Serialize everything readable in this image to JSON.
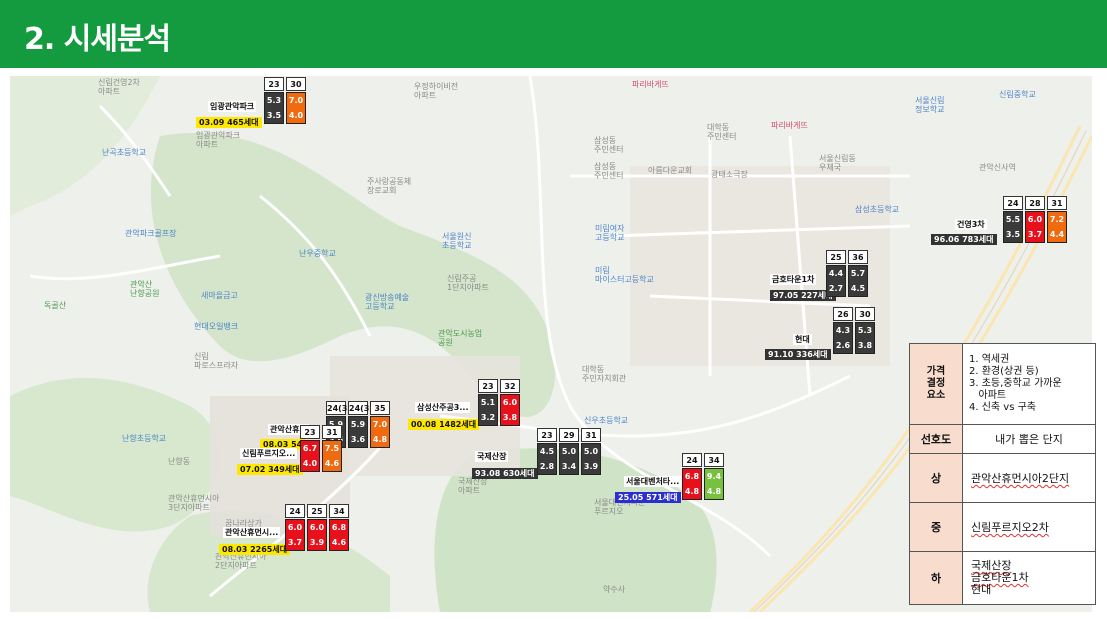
{
  "header": {
    "title": "2. 시세분석"
  },
  "map_labels": [
    {
      "text": "신림건영2차\n아파트",
      "cls": ""
    },
    {
      "text": "우정하이비전\n아파트",
      "cls": ""
    },
    {
      "text": "삼성동\n주민센터",
      "cls": ""
    },
    {
      "text": "삼성동\n주민센터",
      "cls": ""
    },
    {
      "text": "파리바게뜨",
      "cls": "red"
    },
    {
      "text": "대학동\n주민센터",
      "cls": ""
    },
    {
      "text": "서울신림\n정보학교",
      "cls": "blue"
    },
    {
      "text": "신림중학교",
      "cls": "blue"
    },
    {
      "text": "난곡초등학교",
      "cls": "blue"
    },
    {
      "text": "주사랑공동체\n장로교회",
      "cls": ""
    },
    {
      "text": "아름다운교회",
      "cls": ""
    },
    {
      "text": "광태소극장",
      "cls": ""
    },
    {
      "text": "서울신림동\n우체국",
      "cls": ""
    },
    {
      "text": "관악신사역",
      "cls": ""
    },
    {
      "text": "삼성초등학교",
      "cls": "blue"
    },
    {
      "text": "관악파크골프장",
      "cls": "blue"
    },
    {
      "text": "서울원신\n초등학교",
      "cls": "blue"
    },
    {
      "text": "미림여자\n고등학교",
      "cls": "blue"
    },
    {
      "text": "미림\n마이스터고등학교",
      "cls": "blue"
    },
    {
      "text": "난우중학교",
      "cls": "blue"
    },
    {
      "text": "관악산\n난향공원",
      "cls": "green"
    },
    {
      "text": "새마을금고",
      "cls": "blue"
    },
    {
      "text": "신림주공\n1단지아파트",
      "cls": ""
    },
    {
      "text": "독골산",
      "cls": "green"
    },
    {
      "text": "현대오일뱅크",
      "cls": "blue"
    },
    {
      "text": "광신방송예술\n고등학교",
      "cls": "blue"
    },
    {
      "text": "관악도시농업\n공원",
      "cls": "green"
    },
    {
      "text": "신림\n파로스프라자",
      "cls": ""
    },
    {
      "text": "대학동\n주민자치회관",
      "cls": ""
    },
    {
      "text": "난향초등학교",
      "cls": "blue"
    },
    {
      "text": "난향동",
      "cls": ""
    },
    {
      "text": "신우초등학교",
      "cls": "blue"
    },
    {
      "text": "관악산휴먼시아\n3단지아파트",
      "cls": ""
    },
    {
      "text": "꿈나라상가",
      "cls": ""
    },
    {
      "text": "국제산장\n아파트",
      "cls": ""
    },
    {
      "text": "서울대벤처타운\n푸르지오",
      "cls": ""
    },
    {
      "text": "관악산휴먼시아\n2단지아파트",
      "cls": ""
    },
    {
      "text": "약수사",
      "cls": ""
    },
    {
      "text": "파리바게뜨",
      "cls": "red"
    },
    {
      "text": "임광관악파크\n아파트",
      "cls": ""
    }
  ],
  "apartments": [
    {
      "id": "imgwang",
      "headers": [
        "23",
        "30"
      ],
      "cols": [
        {
          "c": "dark",
          "a": "5.3",
          "b": "3.5"
        },
        {
          "c": "orange",
          "a": "7.0",
          "b": "4.0"
        }
      ],
      "name": "임광관악파크",
      "info": "03.09 465세대",
      "info_cls": "yellow"
    },
    {
      "id": "geonyoung",
      "headers": [
        "24",
        "28",
        "31"
      ],
      "cols": [
        {
          "c": "dark",
          "a": "5.5",
          "b": "3.5"
        },
        {
          "c": "red",
          "a": "6.0",
          "b": "3.7"
        },
        {
          "c": "orange",
          "a": "7.2",
          "b": "4.4"
        }
      ],
      "name": "건영3차",
      "info": "96.06 783세대",
      "info_cls": "dark"
    },
    {
      "id": "geumho",
      "headers": [
        "25",
        "36"
      ],
      "cols": [
        {
          "c": "dark",
          "a": "4.4",
          "b": "2.7"
        },
        {
          "c": "dark",
          "a": "5.7",
          "b": "4.5"
        }
      ],
      "name": "금호타운1차",
      "info": "97.05 227세대",
      "info_cls": "dark"
    },
    {
      "id": "hyundai",
      "headers": [
        "26",
        "30"
      ],
      "cols": [
        {
          "c": "dark",
          "a": "4.3",
          "b": "2.6"
        },
        {
          "c": "dark",
          "a": "5.3",
          "b": "3.8"
        }
      ],
      "name": "현대",
      "info": "91.10 336세대",
      "info_cls": "dark"
    },
    {
      "id": "samsung",
      "headers": [
        "23",
        "32"
      ],
      "cols": [
        {
          "c": "dark",
          "a": "5.1",
          "b": "3.2"
        },
        {
          "c": "red",
          "a": "6.0",
          "b": "3.8"
        }
      ],
      "name": "삼성산주공3...",
      "info": "00.08 1482세대",
      "info_cls": "yellow"
    },
    {
      "id": "gukje",
      "headers": [
        "23",
        "29",
        "31"
      ],
      "cols": [
        {
          "c": "dark",
          "a": "4.5",
          "b": "2.8"
        },
        {
          "c": "dark",
          "a": "5.0",
          "b": "3.4"
        },
        {
          "c": "dark",
          "a": "5.0",
          "b": "3.9"
        }
      ],
      "name": "국제산장",
      "info": "93.08 630세대",
      "info_cls": "dark"
    },
    {
      "id": "venture",
      "headers": [
        "24",
        "34"
      ],
      "cols": [
        {
          "c": "red",
          "a": "6.8",
          "b": "4.8"
        },
        {
          "c": "green",
          "a": "9.4",
          "b": "4.8"
        }
      ],
      "name": "서울대벤처타...",
      "info": "25.05 571세대",
      "info_cls": "blue"
    },
    {
      "id": "human2",
      "headers": [
        "24",
        "25",
        "34"
      ],
      "cols": [
        {
          "c": "red",
          "a": "6.0",
          "b": "3.7"
        },
        {
          "c": "red",
          "a": "6.0",
          "b": "3.9"
        },
        {
          "c": "red",
          "a": "6.8",
          "b": "4.6"
        }
      ],
      "name": "관악산휴먼시...",
      "info": "08.03 2265세대",
      "info_cls": "yellow"
    },
    {
      "id": "human3",
      "headers": [
        "24(3.",
        "24(3.",
        "35"
      ],
      "cols": [
        {
          "c": "dark",
          "a": "5.9",
          "b": "3.6"
        },
        {
          "c": "dark",
          "a": "5.9",
          "b": "3.6"
        },
        {
          "c": "orange",
          "a": "7.0",
          "b": "4.8"
        }
      ],
      "name": "관악산휴먼",
      "info": "08.03 54",
      "info_cls": "yellow"
    },
    {
      "id": "prugio",
      "headers": [
        "23",
        "31"
      ],
      "cols": [
        {
          "c": "red",
          "a": "6.7",
          "b": "4.0"
        },
        {
          "c": "orange",
          "a": "7.5",
          "b": "4.6"
        }
      ],
      "name": "신림푸르지오...",
      "info": "07.02 349세대",
      "info_cls": "yellow"
    }
  ],
  "table": {
    "factor_key": "가격\n결정\n요소",
    "factors": [
      "1. 역세권",
      "2. 환경(상권 등)",
      "3. 초등,중학교 가까운",
      "   아파트",
      "4. 신축 vs 구축"
    ],
    "pref_key": "선호도",
    "pref_head": "내가 뽑은 단지",
    "rows": [
      {
        "key": "상",
        "values": [
          "관악산휴먼시아2단지"
        ]
      },
      {
        "key": "중",
        "values": [
          "신림푸르지오2차"
        ]
      },
      {
        "key": "하",
        "values": [
          "국제산장",
          "금호타운1차",
          "현대"
        ]
      }
    ]
  }
}
